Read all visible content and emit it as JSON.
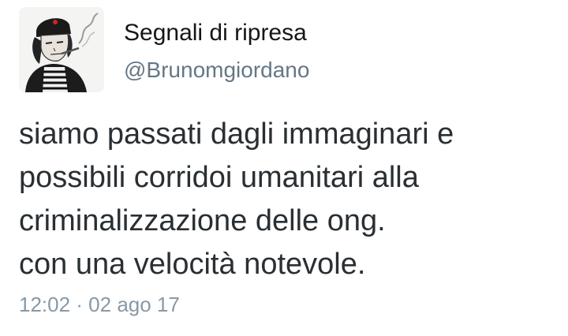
{
  "user": {
    "display_name": "Segnali di ripresa",
    "handle": "@Brunomgiordano",
    "avatar_icon": "profile-avatar-sketch"
  },
  "tweet": {
    "lines": [
      "siamo passati dagli immaginari e",
      "possibili corridoi umanitari alla",
      "criminalizzazione delle ong.",
      "con una velocità notevole."
    ],
    "timestamp": "12:02 · 02 ago 17"
  },
  "colors": {
    "name_text": "#14171a",
    "body_text": "#292f33",
    "handle_text": "#657786",
    "timestamp_text": "#8899a6",
    "background": "#ffffff"
  }
}
